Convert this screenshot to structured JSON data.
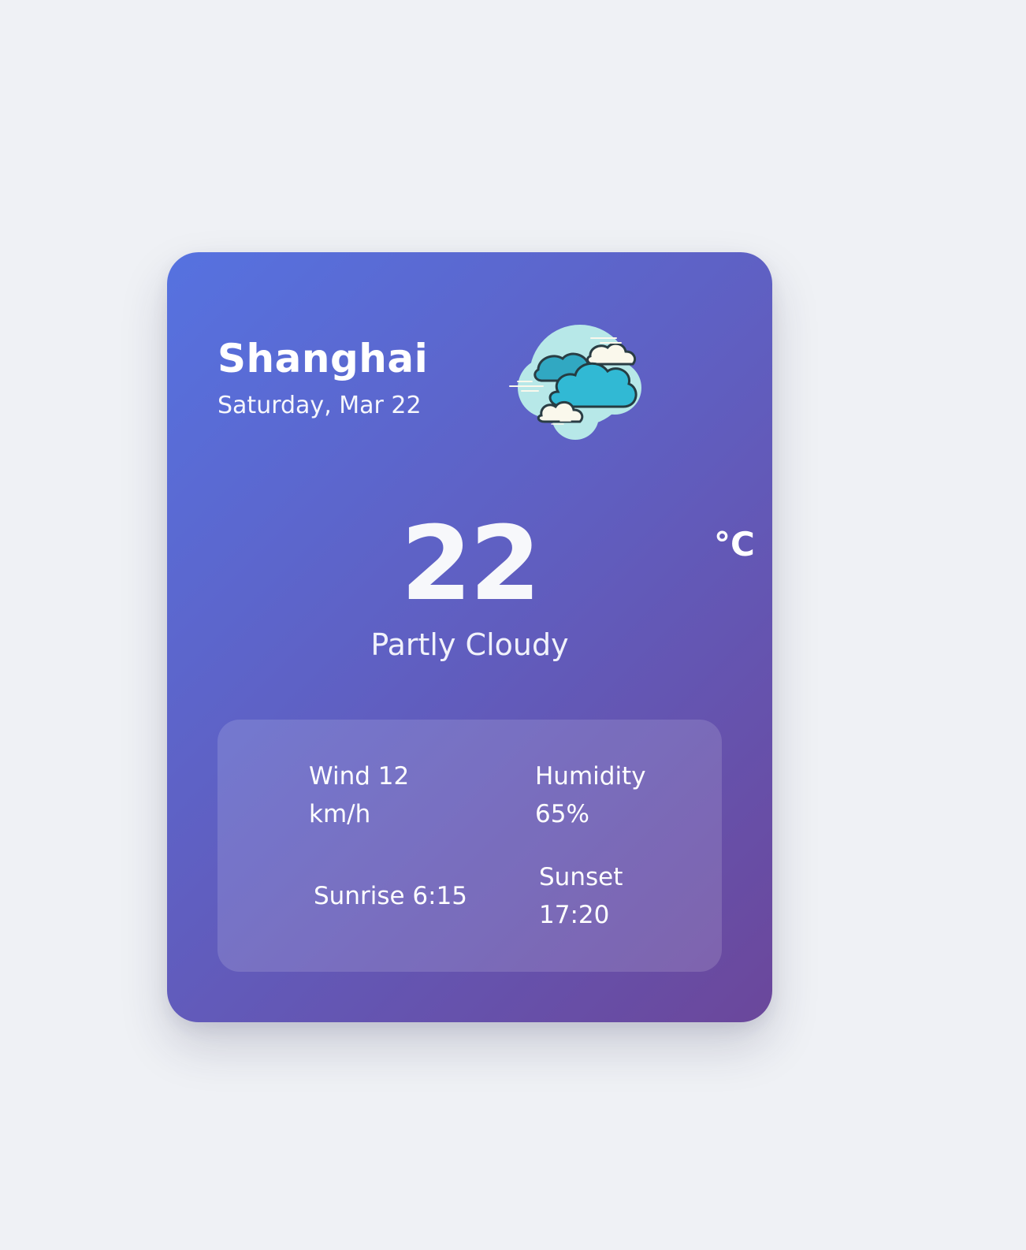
{
  "weather": {
    "city": "Shanghai",
    "date": "Saturday, Mar 22",
    "temperature": "22",
    "unit": "°C",
    "condition": "Partly Cloudy",
    "icon": "partly-cloudy-icon",
    "stats": {
      "wind": "Wind 12 km/h",
      "humidity": "Humidity 65%",
      "sunrise": "Sunrise 6:15",
      "sunset": "Sunset 17:20"
    }
  },
  "colors": {
    "page_background": "#eff1f5",
    "card_gradient_start": "#5672e0",
    "card_gradient_mid": "#5f60c3",
    "card_gradient_end": "#6b479b",
    "text": "#ffffff",
    "cloud_primary": "#31b9d4",
    "cloud_bubble": "#b7e8e8",
    "cloud_light": "#faf8ec"
  }
}
